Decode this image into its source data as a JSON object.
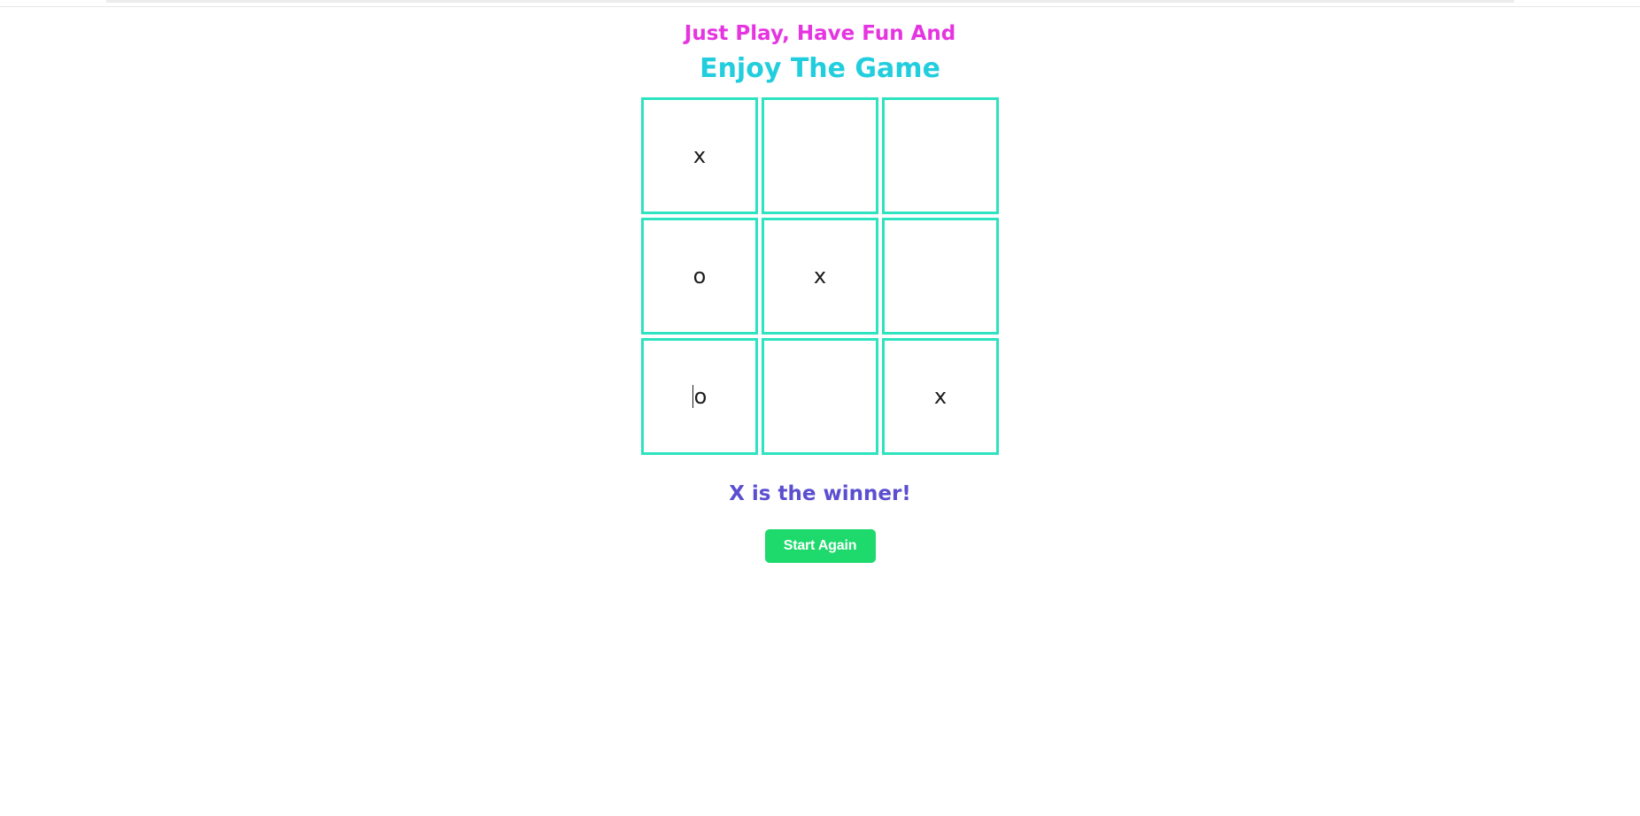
{
  "heading": {
    "subtitle": "Just Play, Have Fun And",
    "title": "Enjoy The Game"
  },
  "board": {
    "cells": [
      "x",
      "",
      "",
      "o",
      "x",
      "",
      "o",
      "",
      "x"
    ]
  },
  "status": {
    "text": "X is the winner!"
  },
  "actions": {
    "restart_label": "Start Again"
  },
  "colors": {
    "subtitle": "#e535e1",
    "title": "#22cedd",
    "cell_border": "#2de3c0",
    "status": "#5b4fd0",
    "button_bg": "#1ed96c"
  }
}
